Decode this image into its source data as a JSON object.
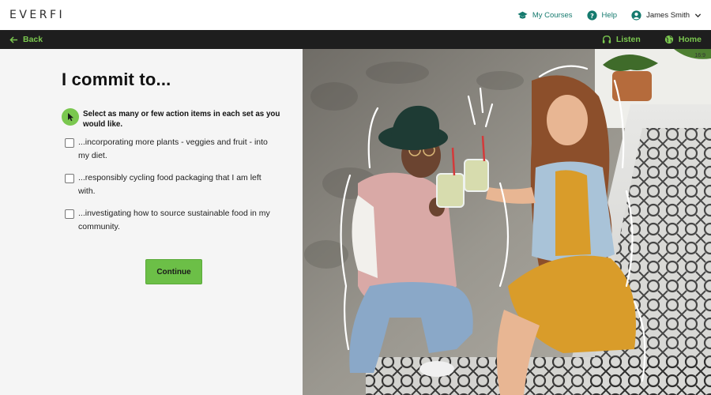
{
  "header": {
    "logo": "EVERFI",
    "links": {
      "my_courses": "My Courses",
      "help": "Help",
      "user_name": "James Smith"
    }
  },
  "nav": {
    "back": "Back",
    "listen": "Listen",
    "home": "Home"
  },
  "main": {
    "title": "I commit to...",
    "instruction": "Select as many or few action items in each set as you would like.",
    "options": [
      {
        "label": "...incorporating more plants - veggies and fruit - into my diet.",
        "checked": false
      },
      {
        "label": "...responsibly cycling food packaging that I am left with.",
        "checked": false
      },
      {
        "label": "...investigating how to source sustainable food in my community.",
        "checked": false
      }
    ],
    "continue_label": "Continue"
  },
  "photo": {
    "aspect_label": "16:9"
  },
  "colors": {
    "accent_green": "#7ac74f",
    "teal": "#157a6e",
    "nav_bg": "#1e1e1e"
  }
}
